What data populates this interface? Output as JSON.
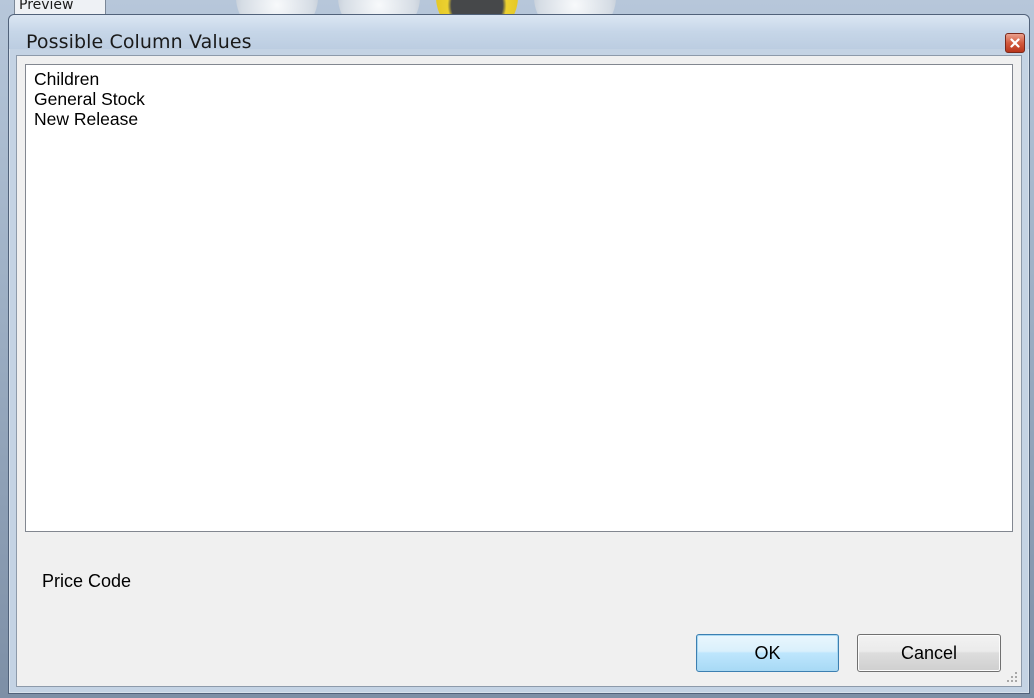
{
  "background_window": {
    "tab_label": "Preview"
  },
  "dialog": {
    "title": "Possible Column Values",
    "close_icon": "close-icon",
    "values": [
      "Children",
      "General Stock",
      "New Release"
    ],
    "column_name": "Price Code",
    "ok_label": "OK",
    "cancel_label": "Cancel"
  },
  "colors": {
    "title_bar": "#c6d6e8",
    "close_button": "#d35a3e",
    "client_background": "#f0f0f0",
    "list_background": "#ffffff",
    "ok_button_border": "#3c7fb1",
    "cancel_button_border": "#707070"
  }
}
